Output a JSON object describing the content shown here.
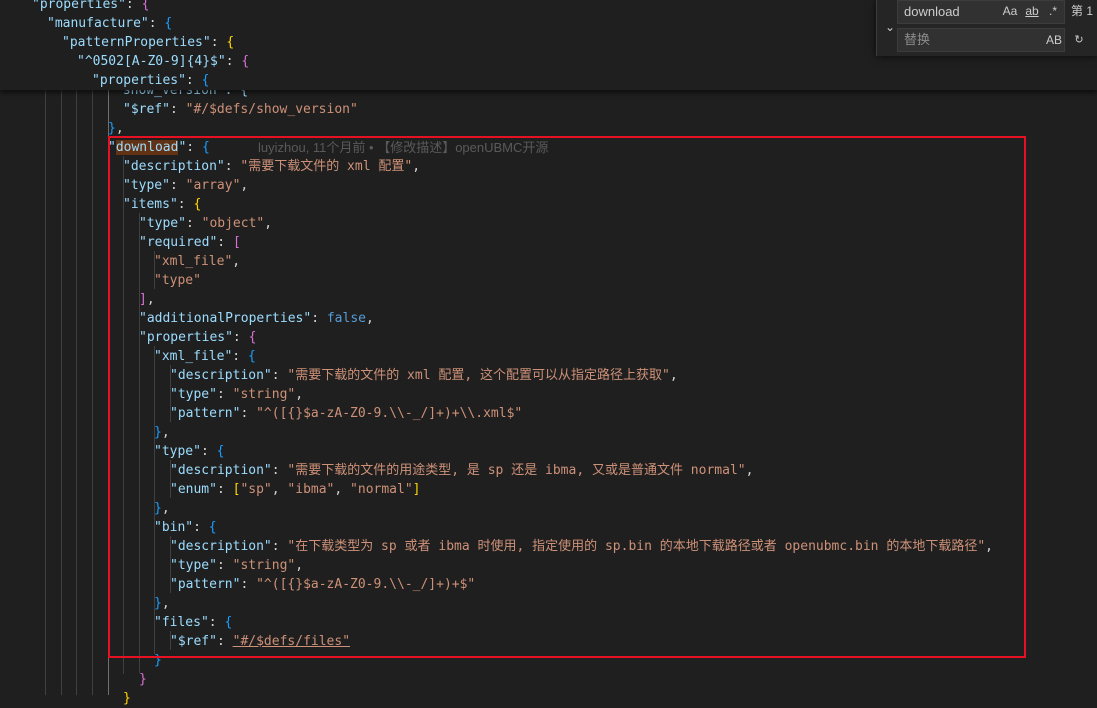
{
  "find_widget": {
    "find_value": "download",
    "replace_placeholder": "替换",
    "match_case": "Aa",
    "match_whole_word": "ab",
    "use_regex": ".*",
    "match_count": "第 1",
    "preserve_case": "AB"
  },
  "sticky": {
    "l1_key": "\"properties\"",
    "l2_key": "\"manufacture\"",
    "l3_key": "\"patternProperties\"",
    "l4_key": "\"^0502[A-Z0-9]{4}$\"",
    "l5_key": "\"properties\""
  },
  "code": {
    "show_version_partial": "\"show_version\": {",
    "ref_key": "\"$ref\"",
    "ref_show_version": "\"#/$defs/show_version\"",
    "download_key": "download",
    "blame": "luyizhou, 11个月前 • 【修改描述】openUBMC开源",
    "description_key": "\"description\"",
    "download_description": "\"需要下载文件的 xml 配置\"",
    "type_key": "\"type\"",
    "array": "\"array\"",
    "items_key": "\"items\"",
    "object": "\"object\"",
    "required_key": "\"required\"",
    "req_xml_file": "\"xml_file\"",
    "req_type": "\"type\"",
    "additional_key": "\"additionalProperties\"",
    "false": "false",
    "properties_key": "\"properties\"",
    "xml_file_key": "\"xml_file\"",
    "xml_file_description": "\"需要下载的文件的 xml 配置, 这个配置可以从指定路径上获取\"",
    "string": "\"string\"",
    "pattern_key": "\"pattern\"",
    "xml_pattern": "\"^([{}$a-zA-Z0-9.\\\\-_/]+)+\\\\.xml$\"",
    "type_description": "\"需要下载的文件的用途类型, 是 sp 还是 ibma, 又或是普通文件 normal\"",
    "enum_key": "\"enum\"",
    "enum_sp": "\"sp\"",
    "enum_ibma": "\"ibma\"",
    "enum_normal": "\"normal\"",
    "bin_key": "\"bin\"",
    "bin_description": "\"在下载类型为 sp 或者 ibma 时使用, 指定使用的 sp.bin 的本地下载路径或者 openubmc.bin 的本地下载路径\"",
    "bin_pattern": "\"^([{}$a-zA-Z0-9.\\\\-_/]+)+$\"",
    "files_key": "\"files\"",
    "ref_files": "\"#/$defs/files\""
  }
}
